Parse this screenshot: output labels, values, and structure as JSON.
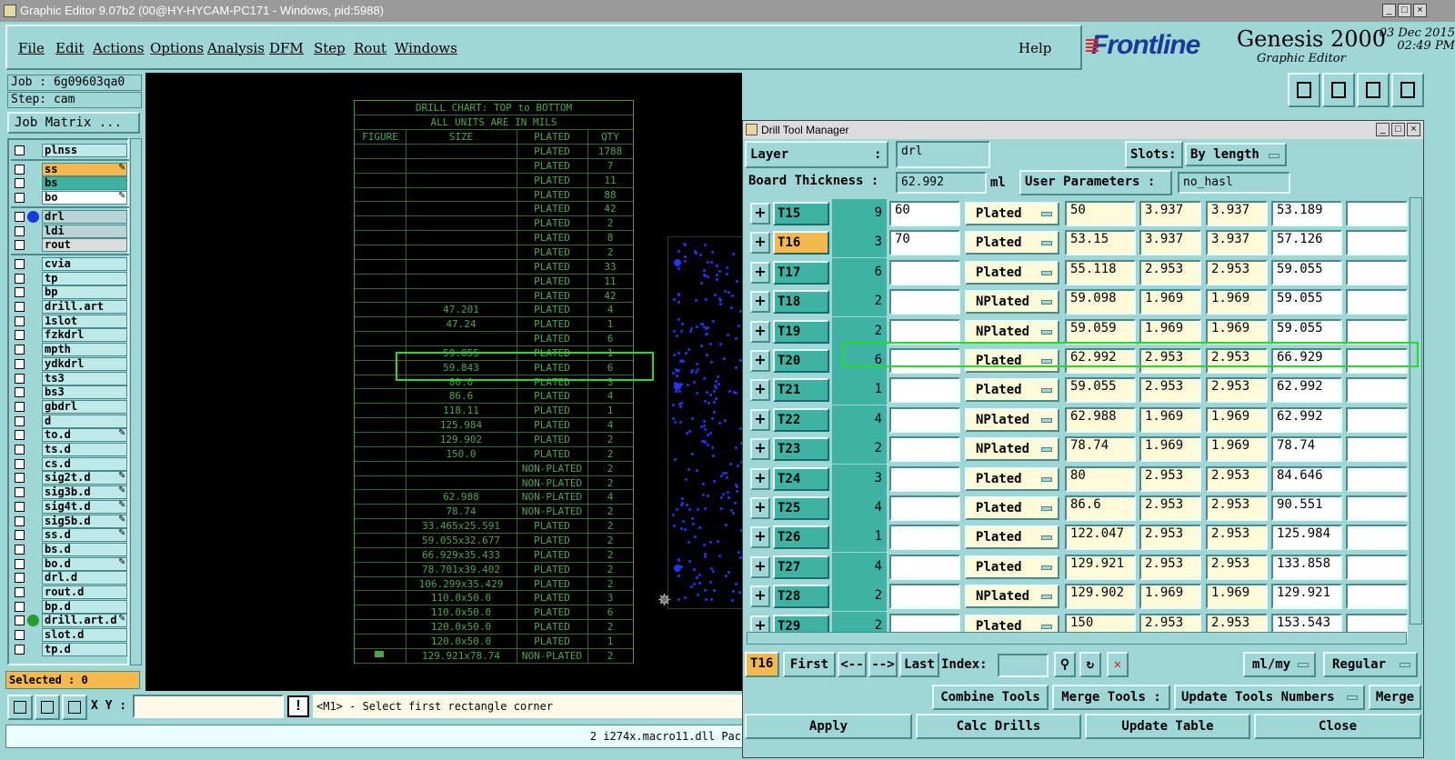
{
  "window": {
    "title": "Graphic Editor 9.07b2 (00@HY-HYCAM-PC171 - Windows, pid:5988)"
  },
  "menu": [
    "File",
    "Edit",
    "Actions",
    "Options",
    "Analysis",
    "DFM",
    "Step",
    "Rout",
    "Windows"
  ],
  "help": "Help",
  "logo": {
    "brand": "Frontline",
    "product": "Genesis 2000",
    "subtitle": "Graphic Editor",
    "date": "03 Dec 2015",
    "time": "02:49 PM"
  },
  "job": {
    "job": "Job : 6g09603qa0",
    "step": "Step: cam",
    "matrix_button": "Job Matrix ..."
  },
  "layers": [
    {
      "name": "plnss",
      "color": "#bde9e9",
      "edit": false,
      "group": 0
    },
    {
      "name": "ss",
      "color": "#f5b84a",
      "edit": true,
      "group": 1
    },
    {
      "name": "bs",
      "color": "#3fb3a3",
      "edit": false,
      "group": 1
    },
    {
      "name": "bo",
      "color": "#ffffff",
      "edit": true,
      "group": 1
    },
    {
      "name": "drl",
      "color": "#b8d4d4",
      "edit": false,
      "group": 2,
      "dot": "#1a3adf"
    },
    {
      "name": "ldi",
      "color": "#b8d4d4",
      "edit": false,
      "group": 2
    },
    {
      "name": "rout",
      "color": "#dcdcdc",
      "edit": false,
      "group": 2
    },
    {
      "name": "cvia",
      "color": "#bde9e9",
      "edit": false,
      "group": 3
    },
    {
      "name": "tp",
      "color": "#bde9e9",
      "edit": false,
      "group": 3
    },
    {
      "name": "bp",
      "color": "#bde9e9",
      "edit": false,
      "group": 3
    },
    {
      "name": "drill.art",
      "color": "#bde9e9",
      "edit": false,
      "group": 3
    },
    {
      "name": "1slot",
      "color": "#bde9e9",
      "edit": false,
      "group": 3
    },
    {
      "name": "fzkdrl",
      "color": "#bde9e9",
      "edit": false,
      "group": 3
    },
    {
      "name": "mpth",
      "color": "#bde9e9",
      "edit": false,
      "group": 3
    },
    {
      "name": "ydkdrl",
      "color": "#bde9e9",
      "edit": false,
      "group": 3
    },
    {
      "name": "ts3",
      "color": "#bde9e9",
      "edit": false,
      "group": 3
    },
    {
      "name": "bs3",
      "color": "#bde9e9",
      "edit": false,
      "group": 3
    },
    {
      "name": "gbdrl",
      "color": "#bde9e9",
      "edit": false,
      "group": 3
    },
    {
      "name": "d",
      "color": "#bde9e9",
      "edit": false,
      "group": 3
    },
    {
      "name": "to.d",
      "color": "#bde9e9",
      "edit": true,
      "group": 3
    },
    {
      "name": "ts.d",
      "color": "#bde9e9",
      "edit": false,
      "group": 3
    },
    {
      "name": "cs.d",
      "color": "#bde9e9",
      "edit": false,
      "group": 3
    },
    {
      "name": "sig2t.d",
      "color": "#bde9e9",
      "edit": true,
      "group": 3
    },
    {
      "name": "sig3b.d",
      "color": "#bde9e9",
      "edit": true,
      "group": 3
    },
    {
      "name": "sig4t.d",
      "color": "#bde9e9",
      "edit": true,
      "group": 3
    },
    {
      "name": "sig5b.d",
      "color": "#bde9e9",
      "edit": true,
      "group": 3
    },
    {
      "name": "ss.d",
      "color": "#bde9e9",
      "edit": true,
      "group": 3
    },
    {
      "name": "bs.d",
      "color": "#bde9e9",
      "edit": false,
      "group": 3
    },
    {
      "name": "bo.d",
      "color": "#bde9e9",
      "edit": true,
      "group": 3
    },
    {
      "name": "drl.d",
      "color": "#bde9e9",
      "edit": false,
      "group": 3
    },
    {
      "name": "rout.d",
      "color": "#bde9e9",
      "edit": false,
      "group": 3
    },
    {
      "name": "bp.d",
      "color": "#bde9e9",
      "edit": false,
      "group": 3
    },
    {
      "name": "drill.art.d",
      "color": "#bde9e9",
      "edit": true,
      "group": 3,
      "dot": "#2a9a2a"
    },
    {
      "name": "slot.d",
      "color": "#bde9e9",
      "edit": false,
      "group": 3
    },
    {
      "name": "tp.d",
      "color": "#bde9e9",
      "edit": false,
      "group": 3
    }
  ],
  "selected": "Selected : 0",
  "drill_chart": {
    "title1": "DRILL CHART: TOP to BOTTOM",
    "title2": "ALL UNITS ARE IN MILS",
    "headers": [
      "FIGURE",
      "SIZE",
      "PLATED",
      "QTY"
    ],
    "rows": [
      [
        "",
        "",
        "PLATED",
        "1788"
      ],
      [
        "",
        "",
        "PLATED",
        "7"
      ],
      [
        "",
        "",
        "PLATED",
        "11"
      ],
      [
        "",
        "",
        "PLATED",
        "88"
      ],
      [
        "",
        "",
        "PLATED",
        "42"
      ],
      [
        "",
        "",
        "PLATED",
        "2"
      ],
      [
        "",
        "",
        "PLATED",
        "8"
      ],
      [
        "",
        "",
        "PLATED",
        "2"
      ],
      [
        "",
        "",
        "PLATED",
        "33"
      ],
      [
        "",
        "",
        "PLATED",
        "11"
      ],
      [
        "",
        "",
        "PLATED",
        "42"
      ],
      [
        "",
        "47.201",
        "PLATED",
        "4"
      ],
      [
        "",
        "47.24",
        "PLATED",
        "1"
      ],
      [
        "",
        "",
        "PLATED",
        "6"
      ],
      [
        "",
        "59.055",
        "PLATED",
        "1"
      ],
      [
        "",
        "59.843",
        "PLATED",
        "6"
      ],
      [
        "",
        "80.0",
        "PLATED",
        "3"
      ],
      [
        "",
        "86.6",
        "PLATED",
        "4"
      ],
      [
        "",
        "118.11",
        "PLATED",
        "1"
      ],
      [
        "",
        "125.984",
        "PLATED",
        "4"
      ],
      [
        "",
        "129.902",
        "PLATED",
        "2"
      ],
      [
        "",
        "150.0",
        "PLATED",
        "2"
      ],
      [
        "",
        "",
        "NON-PLATED",
        "2"
      ],
      [
        "",
        "",
        "NON-PLATED",
        "2"
      ],
      [
        "",
        "62.988",
        "NON-PLATED",
        "4"
      ],
      [
        "",
        "78.74",
        "NON-PLATED",
        "2"
      ],
      [
        "",
        "33.465x25.591",
        "PLATED",
        "2"
      ],
      [
        "",
        "59.055x32.677",
        "PLATED",
        "2"
      ],
      [
        "",
        "66.929x35.433",
        "PLATED",
        "2"
      ],
      [
        "",
        "78.701x39.402",
        "PLATED",
        "2"
      ],
      [
        "",
        "106.299x35.429",
        "PLATED",
        "2"
      ],
      [
        "",
        "110.0x50.0",
        "PLATED",
        "3"
      ],
      [
        "",
        "110.0x50.0",
        "PLATED",
        "6"
      ],
      [
        "",
        "120.0x50.0",
        "PLATED",
        "2"
      ],
      [
        "",
        "120.0x50.0",
        "PLATED",
        "1"
      ],
      [
        "",
        "129.921x78.74",
        "NON-PLATED",
        "2"
      ]
    ]
  },
  "xy_label": "X Y :",
  "prompt": "<M1> - Select first rectangle corner",
  "status": "2 i274x.macro11.dll Pac",
  "dtm": {
    "title": "Drill Tool Manager",
    "layer_label": "Layer",
    "layer_colon": ":",
    "layer_value": "drl",
    "slots_label": "Slots:",
    "slots_value": "By length",
    "thickness_label": "Board Thickness :",
    "thickness_value": "62.992",
    "thickness_unit": "ml",
    "user_params_label": "User Parameters :",
    "user_params_value": "no_hasl",
    "tools": [
      {
        "id": "T15",
        "count": "9",
        "finish": "60",
        "type": "Plated",
        "drill": "50",
        "tol_plus": "3.937",
        "tol_minus": "3.937",
        "size": "53.189",
        "sel": false
      },
      {
        "id": "T16",
        "count": "3",
        "finish": "70",
        "type": "Plated",
        "drill": "53.15",
        "tol_plus": "3.937",
        "tol_minus": "3.937",
        "size": "57.126",
        "sel": true
      },
      {
        "id": "T17",
        "count": "6",
        "finish": "",
        "type": "Plated",
        "drill": "55.118",
        "tol_plus": "2.953",
        "tol_minus": "2.953",
        "size": "59.055",
        "sel": false
      },
      {
        "id": "T18",
        "count": "2",
        "finish": "",
        "type": "NPlated",
        "drill": "59.098",
        "tol_plus": "1.969",
        "tol_minus": "1.969",
        "size": "59.055",
        "sel": false
      },
      {
        "id": "T19",
        "count": "2",
        "finish": "",
        "type": "NPlated",
        "drill": "59.059",
        "tol_plus": "1.969",
        "tol_minus": "1.969",
        "size": "59.055",
        "sel": false
      },
      {
        "id": "T20",
        "count": "6",
        "finish": "",
        "type": "Plated",
        "drill": "62.992",
        "tol_plus": "2.953",
        "tol_minus": "2.953",
        "size": "66.929",
        "sel": false
      },
      {
        "id": "T21",
        "count": "1",
        "finish": "",
        "type": "Plated",
        "drill": "59.055",
        "tol_plus": "2.953",
        "tol_minus": "2.953",
        "size": "62.992",
        "sel": false
      },
      {
        "id": "T22",
        "count": "4",
        "finish": "",
        "type": "NPlated",
        "drill": "62.988",
        "tol_plus": "1.969",
        "tol_minus": "1.969",
        "size": "62.992",
        "sel": false
      },
      {
        "id": "T23",
        "count": "2",
        "finish": "",
        "type": "NPlated",
        "drill": "78.74",
        "tol_plus": "1.969",
        "tol_minus": "1.969",
        "size": "78.74",
        "sel": false
      },
      {
        "id": "T24",
        "count": "3",
        "finish": "",
        "type": "Plated",
        "drill": "80",
        "tol_plus": "2.953",
        "tol_minus": "2.953",
        "size": "84.646",
        "sel": false
      },
      {
        "id": "T25",
        "count": "4",
        "finish": "",
        "type": "Plated",
        "drill": "86.6",
        "tol_plus": "2.953",
        "tol_minus": "2.953",
        "size": "90.551",
        "sel": false
      },
      {
        "id": "T26",
        "count": "1",
        "finish": "",
        "type": "Plated",
        "drill": "122.047",
        "tol_plus": "2.953",
        "tol_minus": "2.953",
        "size": "125.984",
        "sel": false
      },
      {
        "id": "T27",
        "count": "4",
        "finish": "",
        "type": "Plated",
        "drill": "129.921",
        "tol_plus": "2.953",
        "tol_minus": "2.953",
        "size": "133.858",
        "sel": false
      },
      {
        "id": "T28",
        "count": "2",
        "finish": "",
        "type": "NPlated",
        "drill": "129.902",
        "tol_plus": "1.969",
        "tol_minus": "1.969",
        "size": "129.921",
        "sel": false
      },
      {
        "id": "T29",
        "count": "2",
        "finish": "",
        "type": "Plated",
        "drill": "150",
        "tol_plus": "2.953",
        "tol_minus": "2.953",
        "size": "153.543",
        "sel": false
      }
    ],
    "current_tool": "T16",
    "nav": {
      "first": "First",
      "prev": "<--",
      "next": "-->",
      "last": "Last",
      "index": "Index:"
    },
    "units": "ml/my",
    "mode": "Regular",
    "buttons": {
      "combine": "Combine Tools",
      "merge_tools": "Merge Tools :",
      "update_numbers": "Update Tools Numbers",
      "merge": "Merge",
      "apply": "Apply",
      "calc": "Calc Drills",
      "update_table": "Update Table",
      "close": "Close"
    }
  },
  "colors": {
    "panel": "#9fd6d6",
    "tool_cell": "#3fb3a3",
    "selected": "#f5b84a",
    "chart_green": "#4aa84a",
    "highlight": "#22dd22"
  }
}
